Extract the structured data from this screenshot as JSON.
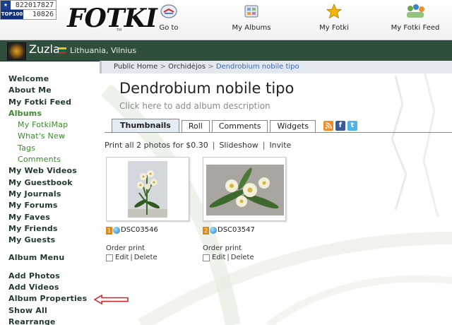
{
  "counter": {
    "visits": "822017827",
    "top_label": "TOP100",
    "top_value": "10826"
  },
  "header": {
    "logo": "FOTKI",
    "logo_tm": "TM",
    "nav": [
      {
        "label": "Go to",
        "icon": "goto-icon"
      },
      {
        "label": "My Albums",
        "icon": "albums-icon"
      },
      {
        "label": "My Fotki",
        "icon": "star-icon"
      },
      {
        "label": "My Fotki Feed",
        "icon": "feed-icon"
      }
    ]
  },
  "user": {
    "name": "Zuzla",
    "location": "Lithuania, Vilnius"
  },
  "sidebar": {
    "items": [
      {
        "label": "Welcome"
      },
      {
        "label": "About Me"
      },
      {
        "label": "My Fotki Feed"
      },
      {
        "label": "Albums"
      },
      {
        "label": "My FotkiMap"
      },
      {
        "label": "What's New"
      },
      {
        "label": "Tags"
      },
      {
        "label": "Comments"
      },
      {
        "label": "My Web Videos"
      },
      {
        "label": "My Guestbook"
      },
      {
        "label": "My Journals"
      },
      {
        "label": "My Forums"
      },
      {
        "label": "My Faves"
      },
      {
        "label": "My Friends"
      },
      {
        "label": "My Guests"
      }
    ],
    "menu_title": "Album Menu",
    "menu": [
      {
        "label": "Add Photos"
      },
      {
        "label": "Add Videos"
      },
      {
        "label": "Album Properties"
      },
      {
        "label": "Show All"
      },
      {
        "label": "Rearrange"
      }
    ]
  },
  "breadcrumb": {
    "home": "Public Home",
    "sep": ">",
    "parent": "Orchidėjos",
    "current": "Dendrobium nobile tipo"
  },
  "album": {
    "title": "Dendrobium nobile tipo",
    "description_placeholder": "Click here to add album description"
  },
  "tabs": [
    {
      "label": "Thumbnails",
      "active": true
    },
    {
      "label": "Roll",
      "active": false
    },
    {
      "label": "Comments",
      "active": false
    },
    {
      "label": "Widgets",
      "active": false
    }
  ],
  "social": {
    "rss": "rss-icon",
    "facebook": "f",
    "twitter": "t"
  },
  "actions": {
    "print": "Print all 2 photos for $0.30",
    "slideshow": "Slideshow",
    "invite": "Invite",
    "sep": "|"
  },
  "photos": [
    {
      "index": "1",
      "name": "DSC03546",
      "order_label": "Order print",
      "edit": "Edit",
      "delete": "Delete",
      "sep": "|"
    },
    {
      "index": "2",
      "name": "DSC03547",
      "order_label": "Order print",
      "edit": "Edit",
      "delete": "Delete",
      "sep": "|"
    }
  ],
  "colors": {
    "header_green": "#2f4f3c",
    "link_green": "#3b8a2a",
    "breadcrumb_blue": "#3a6ab0",
    "annotation_red": "#d02020"
  }
}
